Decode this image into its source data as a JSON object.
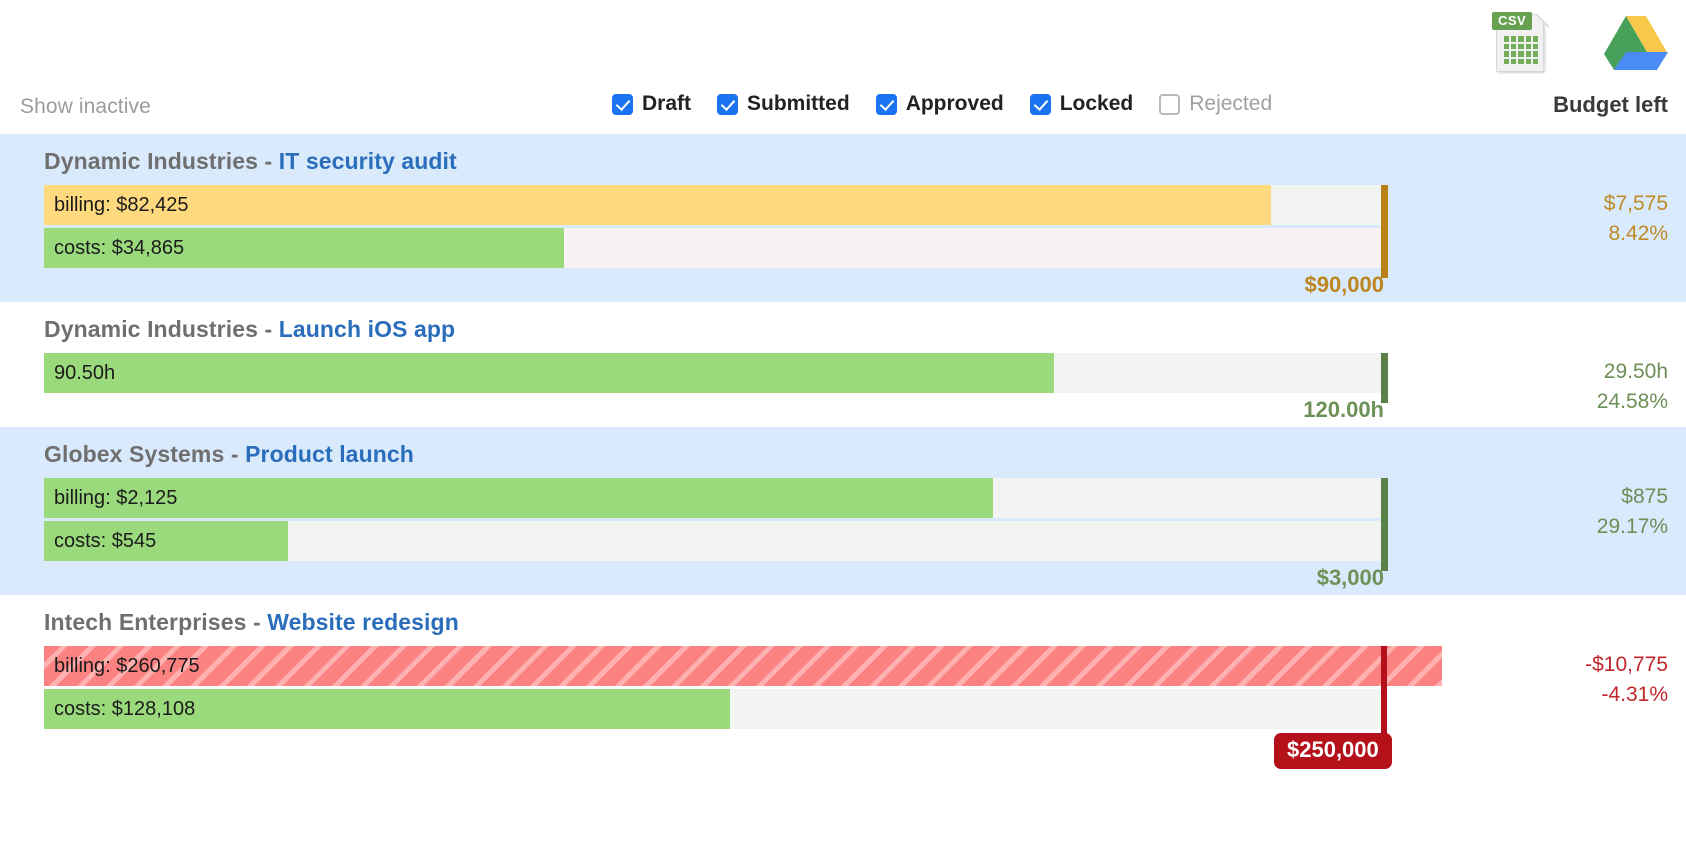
{
  "header": {
    "show_inactive_label": "Show inactive",
    "budget_left_label": "Budget left",
    "csv_icon_name": "csv-export-icon",
    "csv_icon_tag": "CSV",
    "drive_icon_name": "google-drive-icon"
  },
  "filters": [
    {
      "label": "Draft",
      "checked": true
    },
    {
      "label": "Submitted",
      "checked": true
    },
    {
      "label": "Approved",
      "checked": true
    },
    {
      "label": "Locked",
      "checked": true
    },
    {
      "label": "Rejected",
      "checked": false
    }
  ],
  "colors": {
    "accent_blue": "#1a73f0",
    "link_blue": "#2a6ebb",
    "row_alt_bg": "#d9eafc",
    "bar_yellow": "#ffd97d",
    "bar_green": "#9ada7c",
    "bar_red": "#fc8281",
    "marker_gold": "#b98118",
    "marker_olive": "#5b8149",
    "marker_crimson": "#b5111a"
  },
  "rows": [
    {
      "client": "Dynamic Industries - ",
      "project": "IT security audit",
      "striped": true,
      "theme": "gold",
      "bars": [
        {
          "label": "billing: $82,425",
          "fill": "yellow",
          "pct": 91.6,
          "track": "cool"
        },
        {
          "label": "costs: $34,865",
          "fill": "green",
          "pct": 38.8,
          "track": "warm"
        }
      ],
      "marker_pct": 100,
      "budget_caption": "$90,000",
      "left_amount": "$7,575",
      "left_percent": "8.42%"
    },
    {
      "client": "Dynamic Industries - ",
      "project": "Launch iOS app",
      "striped": false,
      "theme": "olive",
      "bars": [
        {
          "label": "90.50h",
          "fill": "green",
          "pct": 75.4,
          "track": "cool"
        }
      ],
      "marker_pct": 100,
      "budget_caption": "120.00h",
      "left_amount": "29.50h",
      "left_percent": "24.58%"
    },
    {
      "client": "Globex Systems - ",
      "project": "Product launch",
      "striped": true,
      "theme": "olive",
      "bars": [
        {
          "label": "billing: $2,125",
          "fill": "green",
          "pct": 70.8,
          "track": "cool"
        },
        {
          "label": "costs: $545",
          "fill": "green",
          "pct": 18.2,
          "track": "cool"
        }
      ],
      "marker_pct": 100,
      "budget_caption": "$3,000",
      "left_amount": "$875",
      "left_percent": "29.17%"
    },
    {
      "client": "Intech Enterprises - ",
      "project": "Website redesign",
      "striped": false,
      "theme": "crimson",
      "bars": [
        {
          "label": "billing: $260,775",
          "fill": "red",
          "pct": 104.3,
          "track": "cool"
        },
        {
          "label": "costs: $128,108",
          "fill": "green",
          "pct": 51.2,
          "track": "cool"
        }
      ],
      "marker_pct": 100,
      "budget_caption": "$250,000",
      "left_amount": "-$10,775",
      "left_percent": "-4.31%"
    }
  ]
}
